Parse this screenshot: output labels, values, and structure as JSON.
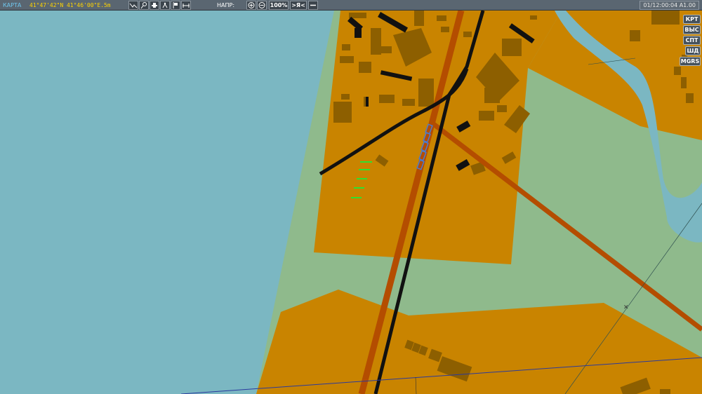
{
  "toolbar": {
    "map_title": "КАРТА",
    "coordinates": "41°47'42\"N 41°46'00\"E.5m",
    "direction_label": "НАПР:",
    "zoom": "100%",
    "center_button": ">Я<",
    "time": "01/12:00:04 A1.00",
    "tool_icons": [
      "route-icon",
      "pin-icon",
      "unit-icon",
      "figure-icon",
      "flag-icon",
      "ruler-icon"
    ]
  },
  "side_buttons": [
    "КРТ",
    "ВЫС",
    "СПТ",
    "ШД",
    "MGRS"
  ],
  "colors": {
    "water": "#7bb7c2",
    "land_green": "#8fba8c",
    "urban": "#c98400",
    "buildings": "#8d5f00",
    "railway": "#111111",
    "road": "#b44d00",
    "toolbar": "#5a6671"
  }
}
